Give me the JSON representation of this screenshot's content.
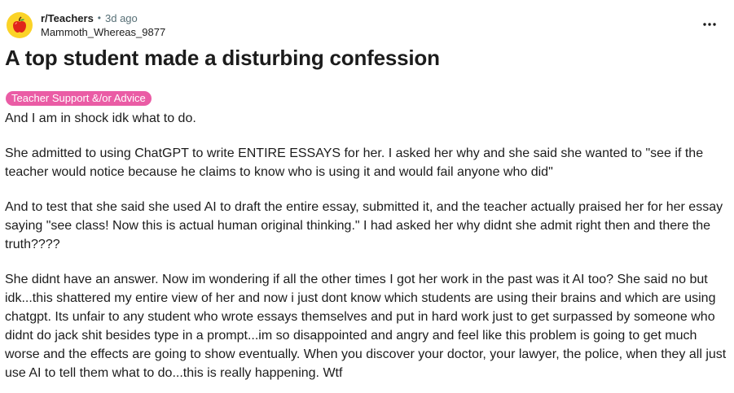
{
  "post": {
    "subreddit": "r/Teachers",
    "separator": "•",
    "time": "3d ago",
    "author": "Mammoth_Whereas_9877",
    "title": "A top student made a disturbing confession",
    "flair": "Teacher Support &/or Advice",
    "flair_color": "#ea5ca5",
    "avatar_color": "#fbd327",
    "avatar_icon": "apple-icon",
    "more_icon": "more-options-icon",
    "paragraphs": [
      "And I am in shock idk what to do.",
      "She admitted to using ChatGPT to write ENTIRE ESSAYS for her. I asked her why and she said she wanted to \"see if the teacher would notice because he claims to know who is using it and would fail anyone who did\"",
      "And to test that she said she used AI to draft the entire essay, submitted it, and the teacher actually praised her for her essay saying \"see class! Now this is actual human original thinking.\" I had asked her why didnt she admit right then and there the truth????",
      "She didnt have an answer. Now im wondering if all the other times I got her work in the past was it AI too? She said no but idk...this shattered my entire view of her and now i just dont know which students are using their brains and which are using chatgpt. Its unfair to any student who wrote essays themselves and put in hard work just to get surpassed by someone who didnt do jack shit besides type in a prompt...im so disappointed and angry and feel like this problem is going to get much worse and the effects are going to show eventually. When you discover your doctor, your lawyer, the police, when they all just use AI to tell them what to do...this is really happening. Wtf"
    ]
  }
}
